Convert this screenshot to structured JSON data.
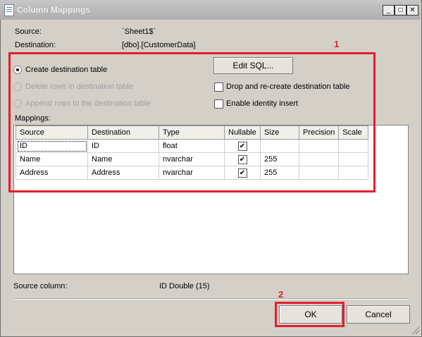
{
  "window": {
    "title": "Column Mappings"
  },
  "source": {
    "label": "Source:",
    "value": "`Sheet1$`"
  },
  "destination": {
    "label": "Destination:",
    "value": "[dbo].[CustomerData]"
  },
  "options": {
    "create_table": "Create destination table",
    "delete_rows": "Delete rows in destination table",
    "append_rows": "Append rows to the destination table",
    "edit_sql": "Edit SQL...",
    "drop_recreate": "Drop and re-create destination table",
    "identity_insert": "Enable identity insert"
  },
  "mappings": {
    "label": "Mappings:",
    "columns": [
      "Source",
      "Destination",
      "Type",
      "Nullable",
      "Size",
      "Precision",
      "Scale"
    ],
    "rows": [
      {
        "source": "ID",
        "destination": "ID",
        "type": "float",
        "nullable": true,
        "size": "",
        "precision": "",
        "scale": ""
      },
      {
        "source": "Name",
        "destination": "Name",
        "type": "nvarchar",
        "nullable": true,
        "size": "255",
        "precision": "",
        "scale": ""
      },
      {
        "source": "Address",
        "destination": "Address",
        "type": "nvarchar",
        "nullable": true,
        "size": "255",
        "precision": "",
        "scale": ""
      }
    ]
  },
  "source_column": {
    "label": "Source column:",
    "value": "ID Double (15)"
  },
  "buttons": {
    "ok": "OK",
    "cancel": "Cancel"
  },
  "annotations": {
    "box1": "1",
    "box2": "2",
    "color": "#e41e2c"
  }
}
